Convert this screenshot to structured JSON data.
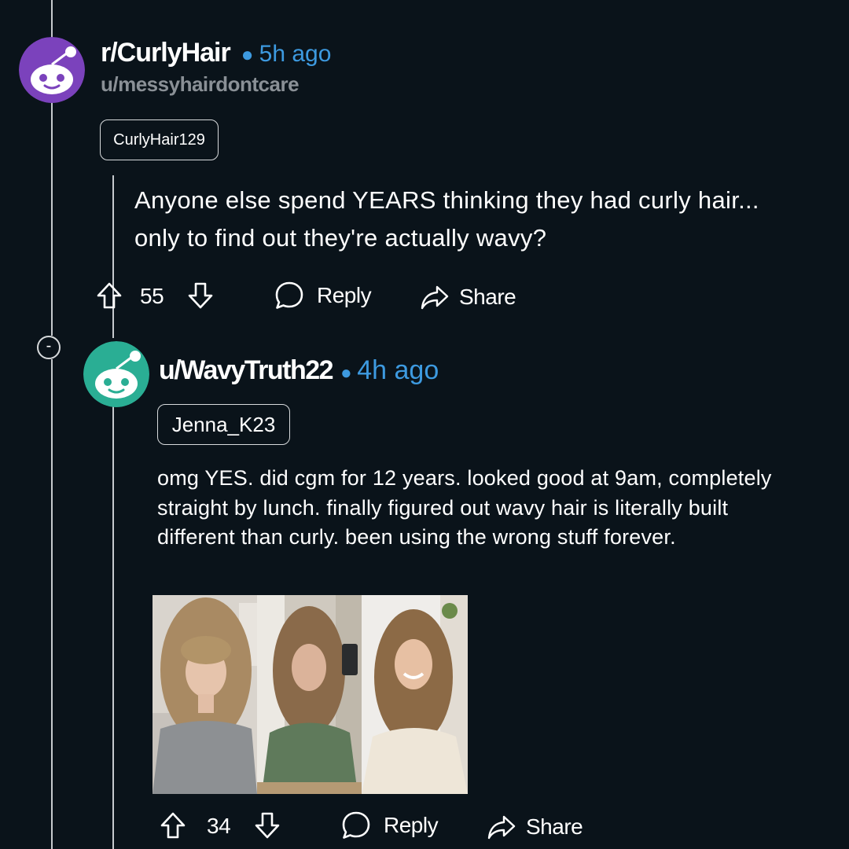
{
  "post": {
    "subreddit": "r/CurlyHair",
    "time": "5h ago",
    "author": "u/messyhairdontcare",
    "flair": "CurlyHair129",
    "body": "Anyone else spend YEARS thinking they had curly hair... only to find out they're actually wavy?",
    "score": "55",
    "reply_label": "Reply",
    "share_label": "Share",
    "avatar_color": "#7b42bc"
  },
  "comment": {
    "collapse_symbol": "-",
    "author": "u/WavyTruth22",
    "time": "4h ago",
    "flair": "Jenna_K23",
    "body": "omg YES. did cgm for 12 years. looked good at 9am, completely straight by lunch. finally figured out wavy hair is literally built different than curly. been using the wrong stuff forever.",
    "score": "34",
    "reply_label": "Reply",
    "share_label": "Share",
    "avatar_color": "#2aae94",
    "photos": [
      "photo-frizzy-hair",
      "photo-mirror-selfie-waves",
      "photo-defined-waves-smiling"
    ]
  },
  "colors": {
    "background": "#0a131a",
    "accent_time": "#3d9ae0",
    "muted_username": "#8a9096",
    "thread_line": "#c6cace"
  }
}
